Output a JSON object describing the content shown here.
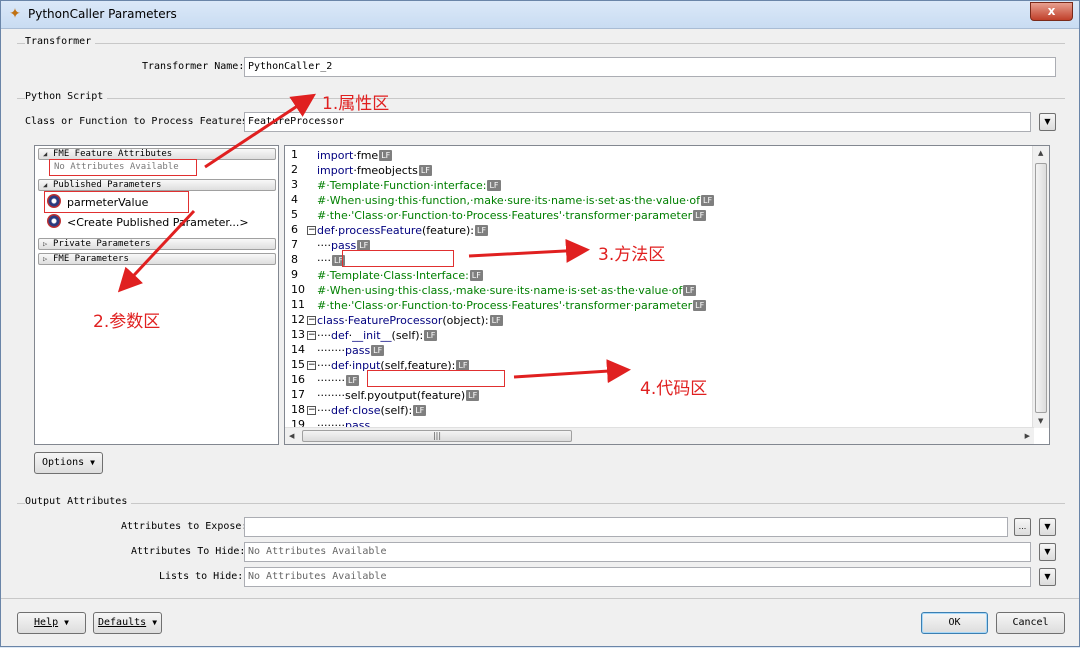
{
  "window": {
    "title": "PythonCaller Parameters",
    "close_label": "x"
  },
  "transformer": {
    "group_title": "Transformer",
    "name_label": "Transformer Name:",
    "name_value": "PythonCaller_2"
  },
  "python_script": {
    "group_title": "Python Script",
    "class_label": "Class or Function to Process Features:",
    "class_value": "FeatureProcessor"
  },
  "param_panel": {
    "sections": [
      {
        "label": "FME Feature Attributes"
      },
      {
        "label": "Published Parameters"
      },
      {
        "label": "Private Parameters"
      },
      {
        "label": "FME Parameters"
      }
    ],
    "no_attributes": "No Attributes Available",
    "published_items": [
      "parmeterValue",
      "<Create Published Parameter...>"
    ]
  },
  "code": {
    "line_numbers": [
      "1",
      "2",
      "3",
      "4",
      "5",
      "6",
      "7",
      "8",
      "9",
      "10",
      "11",
      "12",
      "13",
      "14",
      "15",
      "16",
      "17",
      "18",
      "19"
    ],
    "lf_marker": "LF"
  },
  "annotations": {
    "a1": "1.属性区",
    "a2": "2.参数区",
    "a3": "3.方法区",
    "a4": "4.代码区"
  },
  "options_button": "Options",
  "output": {
    "group_title": "Output Attributes",
    "expose_label": "Attributes to Expose:",
    "expose_value": "",
    "hide_label": "Attributes To Hide:",
    "hide_value": "No Attributes Available",
    "lists_label": "Lists to Hide:",
    "lists_value": "No Attributes Available",
    "ellipsis": "..."
  },
  "footer": {
    "help": "Help",
    "defaults": "Defaults",
    "ok": "OK",
    "cancel": "Cancel"
  }
}
